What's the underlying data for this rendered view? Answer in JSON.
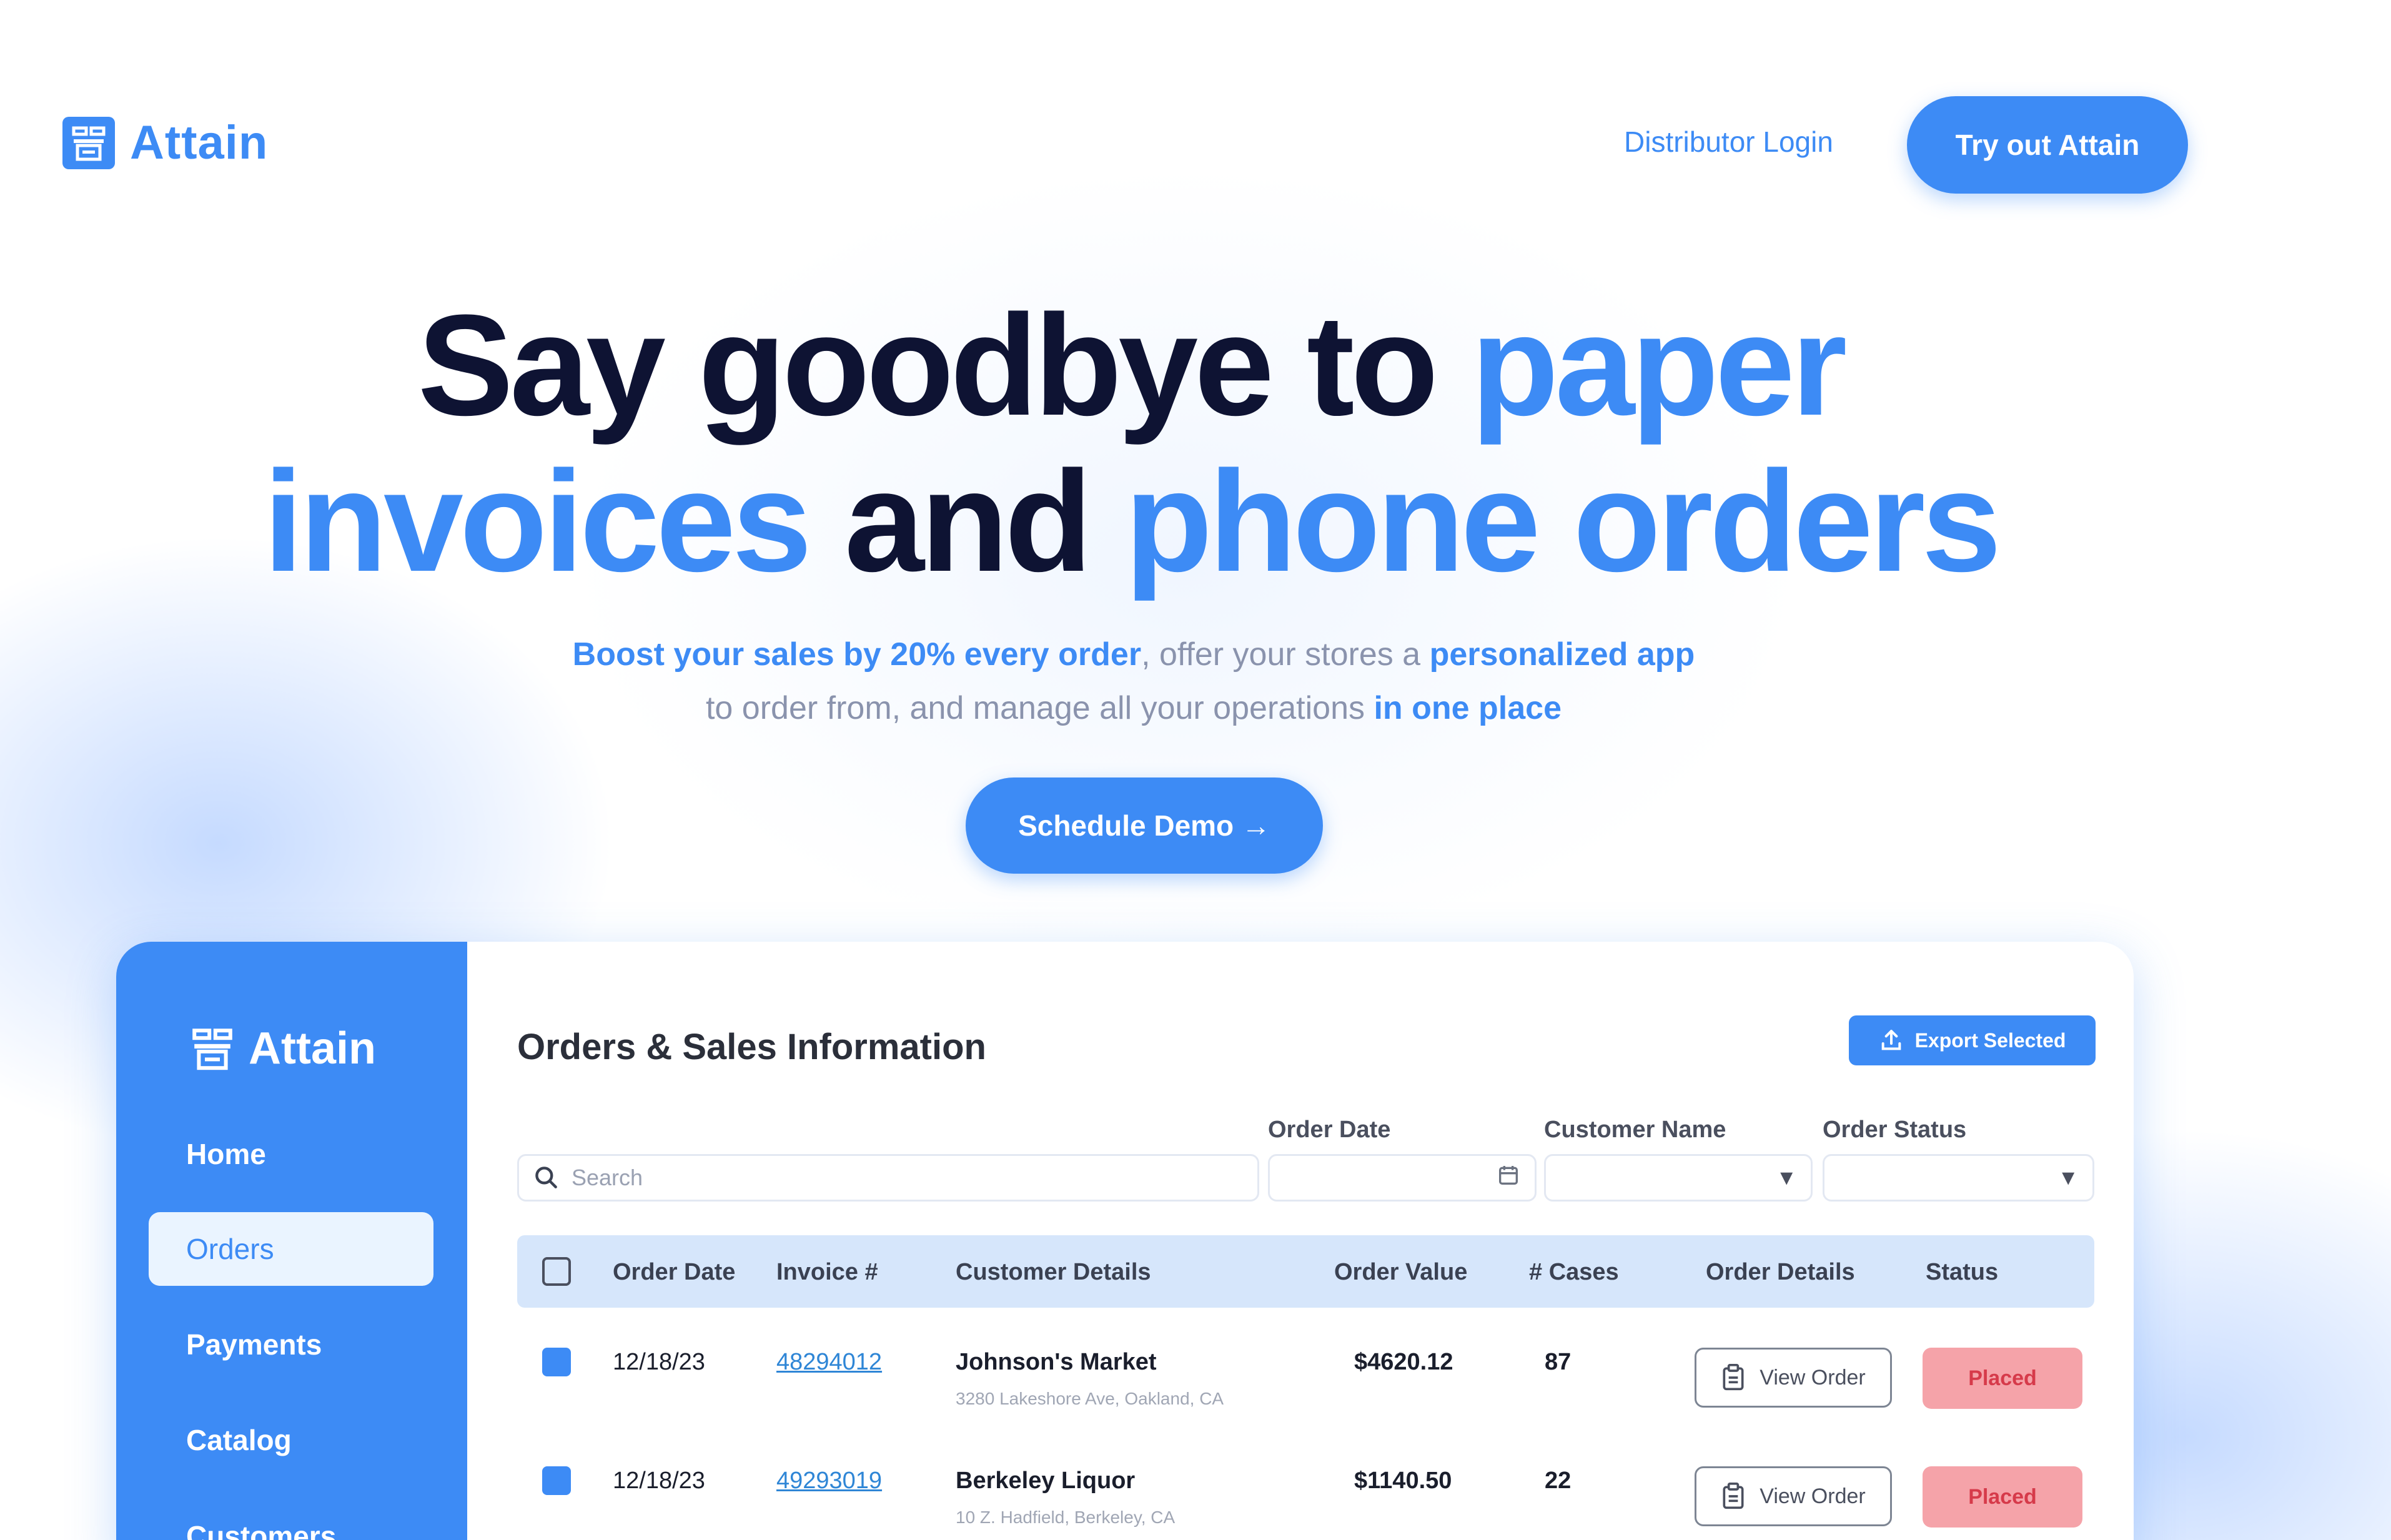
{
  "brand": {
    "name": "Attain",
    "accent": "#3d8bf5",
    "ink": "#0e1333"
  },
  "nav": {
    "distributor_login": "Distributor Login",
    "try_button": "Try out Attain"
  },
  "hero": {
    "title_part1": "Say goodbye to ",
    "title_part2": "paper",
    "title_part3": "invoices",
    "title_part4": " and ",
    "title_part5": "phone orders",
    "sub_hl1": "Boost your sales by 20% every order",
    "sub_text1": ", offer your stores a ",
    "sub_hl2": "personalized app",
    "sub_text2": " to order from, and manage all your operations ",
    "sub_hl3": "in one place",
    "cta": "Schedule Demo →"
  },
  "app": {
    "sidebar": {
      "brand": "Attain",
      "items": [
        {
          "label": "Home"
        },
        {
          "label": "Orders",
          "active": true
        },
        {
          "label": "Payments"
        },
        {
          "label": "Catalog"
        },
        {
          "label": "Customers"
        }
      ]
    },
    "title": "Orders & Sales Information",
    "export_label": "Export Selected",
    "search_placeholder": "Search",
    "filters": {
      "order_date": "Order Date",
      "customer_name": "Customer Name",
      "order_status": "Order Status"
    },
    "columns": {
      "order_date": "Order Date",
      "invoice": "Invoice #",
      "customer": "Customer Details",
      "value": "Order Value",
      "cases": "# Cases",
      "details": "Order Details",
      "status": "Status"
    },
    "rows": [
      {
        "date": "12/18/23",
        "invoice": "48294012",
        "customer": "Johnson's Market",
        "address": "3280 Lakeshore Ave, Oakland, CA",
        "value": "$4620.12",
        "cases": "87",
        "action": "View Order",
        "status": "Placed"
      },
      {
        "date": "12/18/23",
        "invoice": "49293019",
        "customer": "Berkeley Liquor",
        "address": "10 Z. Hadfield, Berkeley, CA",
        "value": "$1140.50",
        "cases": "22",
        "action": "View Order",
        "status": "Placed"
      }
    ]
  }
}
